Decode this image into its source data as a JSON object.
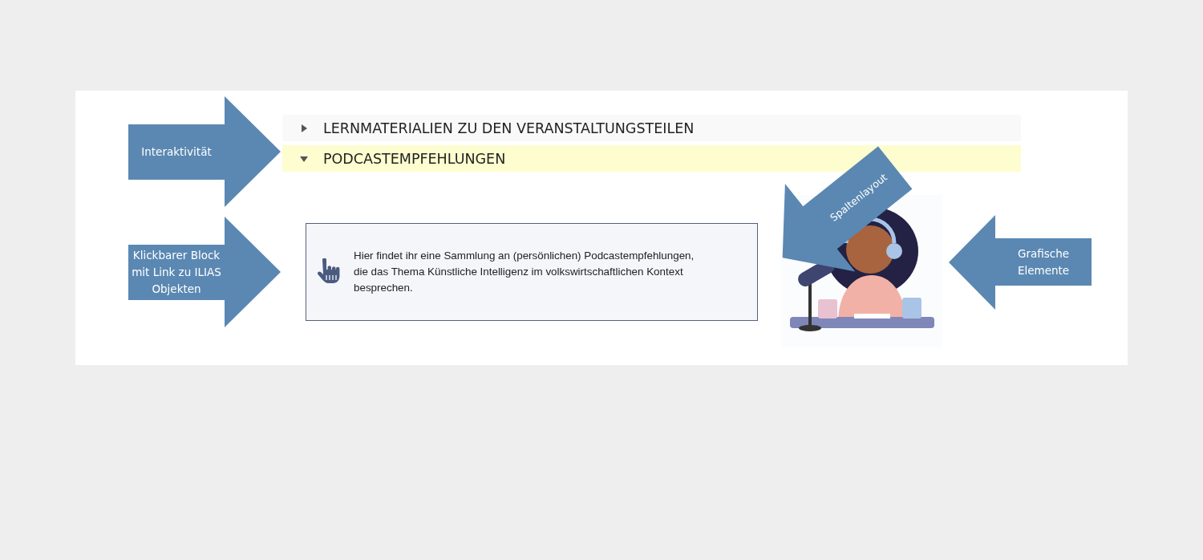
{
  "accordion": [
    {
      "title": "LERNMATERIALIEN ZU DEN VERANSTALTUNGSTEILEN",
      "expanded": false,
      "highlighted": false
    },
    {
      "title": "PODCASTEMPFEHLUNGEN",
      "expanded": true,
      "highlighted": true
    }
  ],
  "link_block": {
    "text": "Hier findet ihr eine Sammlung an (persönlichen) Podcastempfehlungen, die das Thema Künstliche Intelligenz im volkswirtschaftlichen Kontext besprechen."
  },
  "annotations": [
    {
      "kind": "right",
      "label": "Interaktivität"
    },
    {
      "kind": "right",
      "label": "Klickbarer Block mit Link zu ILIAS Objekten"
    },
    {
      "kind": "diagonal",
      "label": "Spaltenlayout"
    },
    {
      "kind": "left",
      "label": "Grafische Elemente"
    }
  ]
}
